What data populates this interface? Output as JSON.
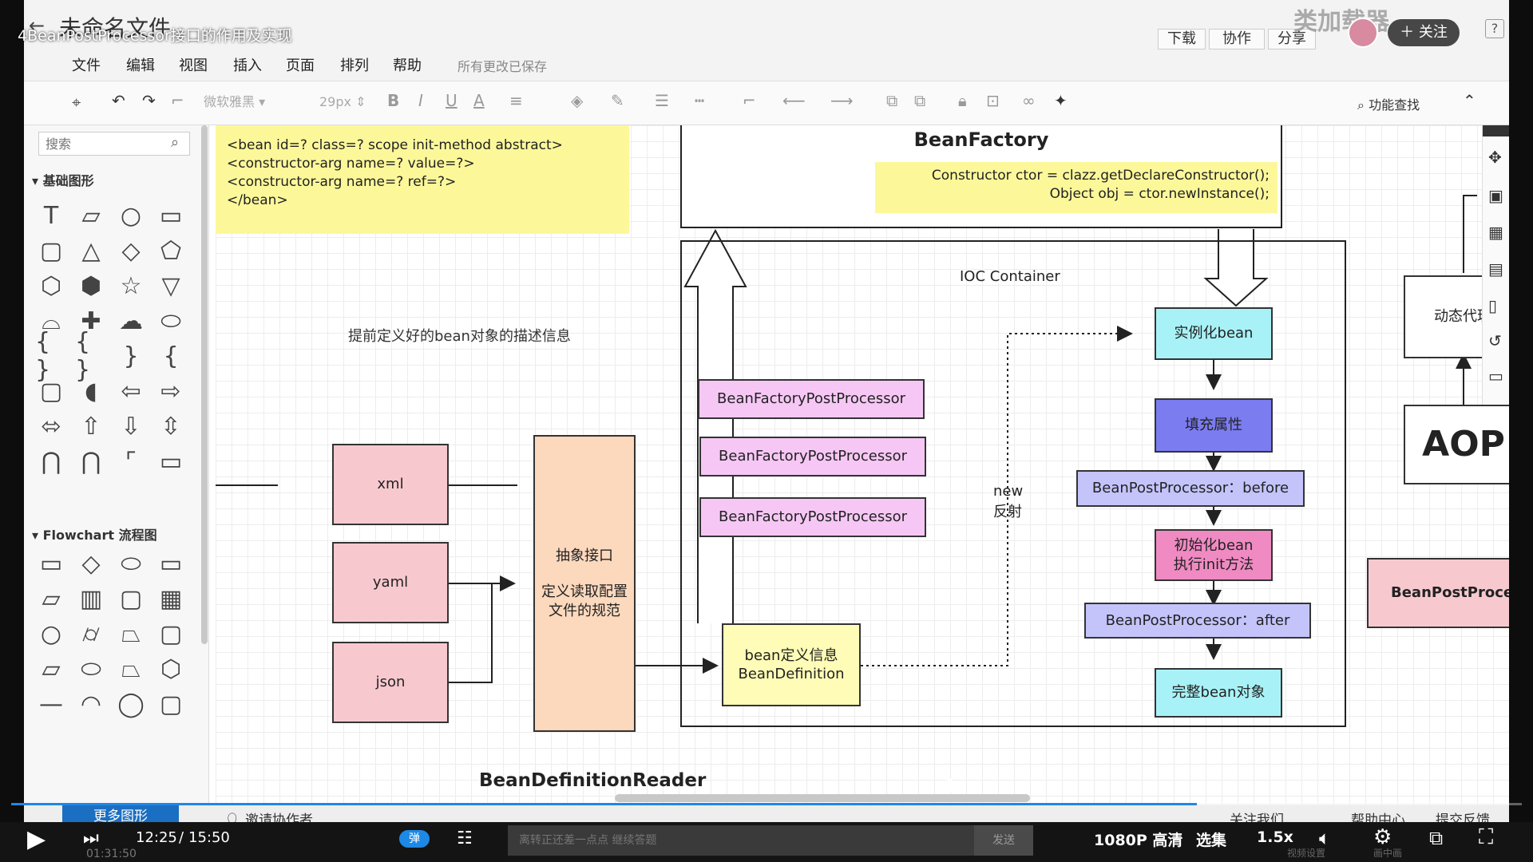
{
  "video": {
    "title": "4BeanPostProcessor接口的作用及实现",
    "follow_label": "关注",
    "watermark": "类加载器",
    "current_time": "12:25",
    "total_time": "15:50",
    "secondary_time": "01:31:50",
    "danmaku_placeholder": "离转正还差一点点 继续答题",
    "send_label": "发送",
    "quality_label": "1080P 高清",
    "episodes_label": "选集",
    "speed_label": "1.5x",
    "danmaku_toggle_label": "弹",
    "progress_fraction": 0.785,
    "accent_color": "#1e88e5"
  },
  "app": {
    "doc_title": "未命名文件",
    "buttons": {
      "download": "下载",
      "collab": "协作",
      "share": "分享"
    },
    "help_label": "?"
  },
  "menu": {
    "items": [
      "文件",
      "编辑",
      "视图",
      "插入",
      "页面",
      "排列",
      "帮助"
    ],
    "status": "所有更改已保存"
  },
  "toolbar": {
    "font_family": "微软雅黑",
    "font_size": "29px",
    "feature_search": "功能查找"
  },
  "sidebar": {
    "search_placeholder": "搜索",
    "basic_section": "基础图形",
    "flowchart_section": "Flowchart 流程图"
  },
  "bottom": {
    "more_shapes": "更多图形",
    "invite": "邀请协作者",
    "contact": "关注我们",
    "help_center": "帮助中心",
    "feedback": "提交反馈",
    "video_settings": "视频设置",
    "pip": "画中画"
  },
  "diagram": {
    "note_lines": [
      "<bean id=? class=? scope init-method  abstract>",
      "<constructor-arg name=? value=?>",
      "<constructor-arg  name=? ref=?>",
      "</bean>"
    ],
    "bean_factory_title": "BeanFactory",
    "ctor_line1": "Constructor ctor = clazz.getDeclareConstructor();",
    "ctor_line2": "Object obj = ctor.newInstance();",
    "ioc_label": "IOC  Container",
    "predefine_label": "提前定义好的bean对象的描述信息",
    "xml": "xml",
    "yaml": "yaml",
    "json": "json",
    "abstract_title": "抽象接口",
    "abstract_desc": "定义读取配置文件的规范",
    "reader_label": "BeanDefinitionReader",
    "bfpp": [
      "BeanFactoryPostProcessor",
      "BeanFactoryPostProcessor",
      "BeanFactoryPostProcessor"
    ],
    "bean_def_line1": "bean定义信息",
    "bean_def_line2": "BeanDefinition",
    "new_label": "new",
    "reflect_label": "反射",
    "instantiate": "实例化bean",
    "populate": "填充属性",
    "bpp_before": "BeanPostProcessor：before",
    "init_line1": "初始化bean",
    "init_line2": "执行init方法",
    "bpp_after": "BeanPostProcessor：after",
    "complete": "完整bean对象",
    "dynamic_proxy": "动态代理",
    "aop": "AOP",
    "bpp_right": "BeanPostProcessor"
  }
}
